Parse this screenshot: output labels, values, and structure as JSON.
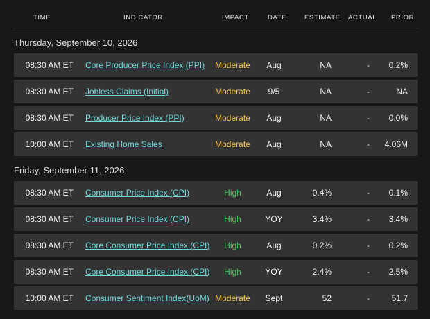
{
  "columns": {
    "time": "TIME",
    "indicator": "INDICATOR",
    "impact": "IMPACT",
    "date": "DATE",
    "estimate": "ESTIMATE",
    "actual": "ACTUAL",
    "prior": "PRIOR"
  },
  "colors": {
    "moderate": "#f4c44a",
    "high": "#43c25a",
    "link": "#6fd6dc",
    "row_bg": "#333333",
    "page_bg": "#181818"
  },
  "days": [
    {
      "label": "Thursday, September 10, 2026",
      "rows": [
        {
          "time": "08:30 AM ET",
          "indicator": "Core Producer Price Index (PPI)",
          "impact": "Moderate",
          "date": "Aug",
          "estimate": "NA",
          "actual": "-",
          "prior": "0.2%"
        },
        {
          "time": "08:30 AM ET",
          "indicator": "Jobless Claims (Initial)",
          "impact": "Moderate",
          "date": "9/5",
          "estimate": "NA",
          "actual": "-",
          "prior": "NA"
        },
        {
          "time": "08:30 AM ET",
          "indicator": "Producer Price Index (PPI)",
          "impact": "Moderate",
          "date": "Aug",
          "estimate": "NA",
          "actual": "-",
          "prior": "0.0%"
        },
        {
          "time": "10:00 AM ET",
          "indicator": "Existing Home Sales",
          "impact": "Moderate",
          "date": "Aug",
          "estimate": "NA",
          "actual": "-",
          "prior": "4.06M"
        }
      ]
    },
    {
      "label": "Friday, September 11, 2026",
      "rows": [
        {
          "time": "08:30 AM ET",
          "indicator": "Consumer Price Index (CPI)",
          "impact": "High",
          "date": "Aug",
          "estimate": "0.4%",
          "actual": "-",
          "prior": "0.1%"
        },
        {
          "time": "08:30 AM ET",
          "indicator": "Consumer Price Index (CPI)",
          "impact": "High",
          "date": "YOY",
          "estimate": "3.4%",
          "actual": "-",
          "prior": "3.4%"
        },
        {
          "time": "08:30 AM ET",
          "indicator": "Core Consumer Price Index (CPI)",
          "impact": "High",
          "date": "Aug",
          "estimate": "0.2%",
          "actual": "-",
          "prior": "0.2%"
        },
        {
          "time": "08:30 AM ET",
          "indicator": "Core Consumer Price Index (CPI)",
          "impact": "High",
          "date": "YOY",
          "estimate": "2.4%",
          "actual": "-",
          "prior": "2.5%"
        },
        {
          "time": "10:00 AM ET",
          "indicator": "Consumer Sentiment Index(UoM)",
          "impact": "Moderate",
          "date": "Sept",
          "estimate": "52",
          "actual": "-",
          "prior": "51.7"
        }
      ]
    }
  ]
}
